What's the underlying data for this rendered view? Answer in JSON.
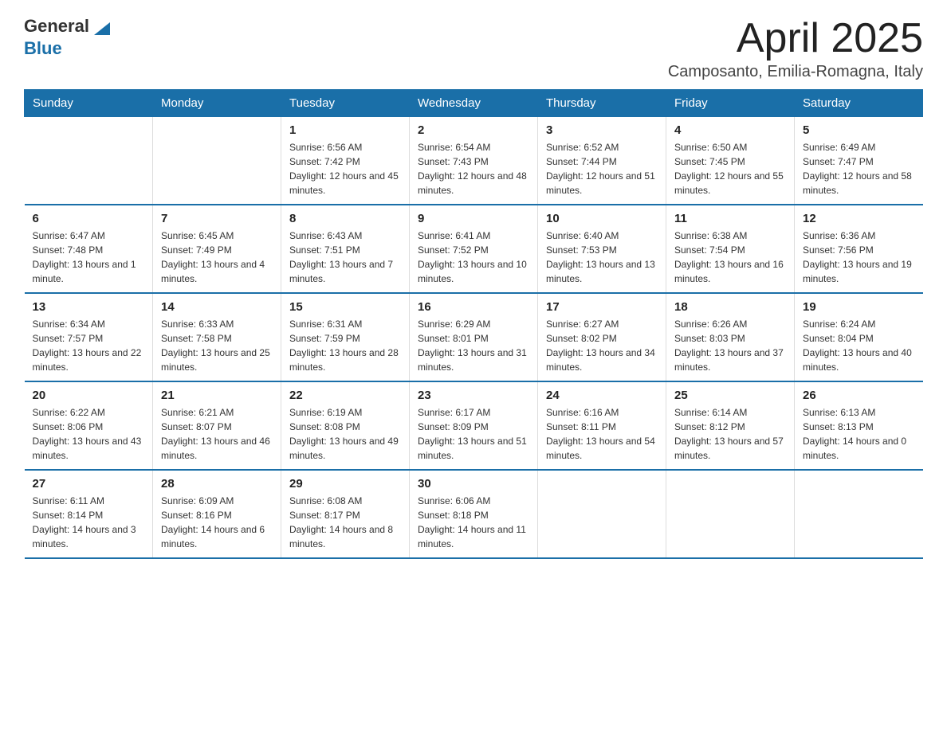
{
  "header": {
    "logo_general": "General",
    "logo_blue": "Blue",
    "month_title": "April 2025",
    "location": "Camposanto, Emilia-Romagna, Italy"
  },
  "weekdays": [
    "Sunday",
    "Monday",
    "Tuesday",
    "Wednesday",
    "Thursday",
    "Friday",
    "Saturday"
  ],
  "weeks": [
    [
      {
        "day": "",
        "sunrise": "",
        "sunset": "",
        "daylight": ""
      },
      {
        "day": "",
        "sunrise": "",
        "sunset": "",
        "daylight": ""
      },
      {
        "day": "1",
        "sunrise": "Sunrise: 6:56 AM",
        "sunset": "Sunset: 7:42 PM",
        "daylight": "Daylight: 12 hours and 45 minutes."
      },
      {
        "day": "2",
        "sunrise": "Sunrise: 6:54 AM",
        "sunset": "Sunset: 7:43 PM",
        "daylight": "Daylight: 12 hours and 48 minutes."
      },
      {
        "day": "3",
        "sunrise": "Sunrise: 6:52 AM",
        "sunset": "Sunset: 7:44 PM",
        "daylight": "Daylight: 12 hours and 51 minutes."
      },
      {
        "day": "4",
        "sunrise": "Sunrise: 6:50 AM",
        "sunset": "Sunset: 7:45 PM",
        "daylight": "Daylight: 12 hours and 55 minutes."
      },
      {
        "day": "5",
        "sunrise": "Sunrise: 6:49 AM",
        "sunset": "Sunset: 7:47 PM",
        "daylight": "Daylight: 12 hours and 58 minutes."
      }
    ],
    [
      {
        "day": "6",
        "sunrise": "Sunrise: 6:47 AM",
        "sunset": "Sunset: 7:48 PM",
        "daylight": "Daylight: 13 hours and 1 minute."
      },
      {
        "day": "7",
        "sunrise": "Sunrise: 6:45 AM",
        "sunset": "Sunset: 7:49 PM",
        "daylight": "Daylight: 13 hours and 4 minutes."
      },
      {
        "day": "8",
        "sunrise": "Sunrise: 6:43 AM",
        "sunset": "Sunset: 7:51 PM",
        "daylight": "Daylight: 13 hours and 7 minutes."
      },
      {
        "day": "9",
        "sunrise": "Sunrise: 6:41 AM",
        "sunset": "Sunset: 7:52 PM",
        "daylight": "Daylight: 13 hours and 10 minutes."
      },
      {
        "day": "10",
        "sunrise": "Sunrise: 6:40 AM",
        "sunset": "Sunset: 7:53 PM",
        "daylight": "Daylight: 13 hours and 13 minutes."
      },
      {
        "day": "11",
        "sunrise": "Sunrise: 6:38 AM",
        "sunset": "Sunset: 7:54 PM",
        "daylight": "Daylight: 13 hours and 16 minutes."
      },
      {
        "day": "12",
        "sunrise": "Sunrise: 6:36 AM",
        "sunset": "Sunset: 7:56 PM",
        "daylight": "Daylight: 13 hours and 19 minutes."
      }
    ],
    [
      {
        "day": "13",
        "sunrise": "Sunrise: 6:34 AM",
        "sunset": "Sunset: 7:57 PM",
        "daylight": "Daylight: 13 hours and 22 minutes."
      },
      {
        "day": "14",
        "sunrise": "Sunrise: 6:33 AM",
        "sunset": "Sunset: 7:58 PM",
        "daylight": "Daylight: 13 hours and 25 minutes."
      },
      {
        "day": "15",
        "sunrise": "Sunrise: 6:31 AM",
        "sunset": "Sunset: 7:59 PM",
        "daylight": "Daylight: 13 hours and 28 minutes."
      },
      {
        "day": "16",
        "sunrise": "Sunrise: 6:29 AM",
        "sunset": "Sunset: 8:01 PM",
        "daylight": "Daylight: 13 hours and 31 minutes."
      },
      {
        "day": "17",
        "sunrise": "Sunrise: 6:27 AM",
        "sunset": "Sunset: 8:02 PM",
        "daylight": "Daylight: 13 hours and 34 minutes."
      },
      {
        "day": "18",
        "sunrise": "Sunrise: 6:26 AM",
        "sunset": "Sunset: 8:03 PM",
        "daylight": "Daylight: 13 hours and 37 minutes."
      },
      {
        "day": "19",
        "sunrise": "Sunrise: 6:24 AM",
        "sunset": "Sunset: 8:04 PM",
        "daylight": "Daylight: 13 hours and 40 minutes."
      }
    ],
    [
      {
        "day": "20",
        "sunrise": "Sunrise: 6:22 AM",
        "sunset": "Sunset: 8:06 PM",
        "daylight": "Daylight: 13 hours and 43 minutes."
      },
      {
        "day": "21",
        "sunrise": "Sunrise: 6:21 AM",
        "sunset": "Sunset: 8:07 PM",
        "daylight": "Daylight: 13 hours and 46 minutes."
      },
      {
        "day": "22",
        "sunrise": "Sunrise: 6:19 AM",
        "sunset": "Sunset: 8:08 PM",
        "daylight": "Daylight: 13 hours and 49 minutes."
      },
      {
        "day": "23",
        "sunrise": "Sunrise: 6:17 AM",
        "sunset": "Sunset: 8:09 PM",
        "daylight": "Daylight: 13 hours and 51 minutes."
      },
      {
        "day": "24",
        "sunrise": "Sunrise: 6:16 AM",
        "sunset": "Sunset: 8:11 PM",
        "daylight": "Daylight: 13 hours and 54 minutes."
      },
      {
        "day": "25",
        "sunrise": "Sunrise: 6:14 AM",
        "sunset": "Sunset: 8:12 PM",
        "daylight": "Daylight: 13 hours and 57 minutes."
      },
      {
        "day": "26",
        "sunrise": "Sunrise: 6:13 AM",
        "sunset": "Sunset: 8:13 PM",
        "daylight": "Daylight: 14 hours and 0 minutes."
      }
    ],
    [
      {
        "day": "27",
        "sunrise": "Sunrise: 6:11 AM",
        "sunset": "Sunset: 8:14 PM",
        "daylight": "Daylight: 14 hours and 3 minutes."
      },
      {
        "day": "28",
        "sunrise": "Sunrise: 6:09 AM",
        "sunset": "Sunset: 8:16 PM",
        "daylight": "Daylight: 14 hours and 6 minutes."
      },
      {
        "day": "29",
        "sunrise": "Sunrise: 6:08 AM",
        "sunset": "Sunset: 8:17 PM",
        "daylight": "Daylight: 14 hours and 8 minutes."
      },
      {
        "day": "30",
        "sunrise": "Sunrise: 6:06 AM",
        "sunset": "Sunset: 8:18 PM",
        "daylight": "Daylight: 14 hours and 11 minutes."
      },
      {
        "day": "",
        "sunrise": "",
        "sunset": "",
        "daylight": ""
      },
      {
        "day": "",
        "sunrise": "",
        "sunset": "",
        "daylight": ""
      },
      {
        "day": "",
        "sunrise": "",
        "sunset": "",
        "daylight": ""
      }
    ]
  ]
}
